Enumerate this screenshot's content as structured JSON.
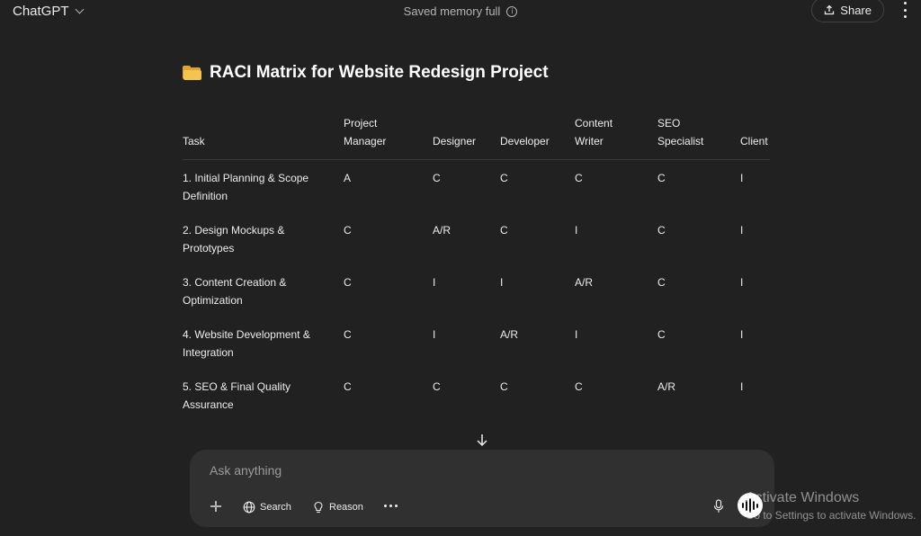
{
  "header": {
    "app_name": "ChatGPT",
    "status_text": "Saved memory full",
    "info_glyph": "i",
    "share_label": "Share"
  },
  "document": {
    "title": "RACI Matrix for Website Redesign Project",
    "title_icon": "folder-icon",
    "table": {
      "headers": [
        {
          "line1": "Task",
          "line2": ""
        },
        {
          "line1": "Project",
          "line2": "Manager"
        },
        {
          "line1": "Designer",
          "line2": ""
        },
        {
          "line1": "Developer",
          "line2": ""
        },
        {
          "line1": "Content",
          "line2": "Writer"
        },
        {
          "line1": "SEO",
          "line2": "Specialist"
        },
        {
          "line1": "Client",
          "line2": ""
        }
      ],
      "rows": [
        {
          "task_line1": "1. Initial Planning & Scope",
          "task_line2": "Definition",
          "cells": [
            "A",
            "C",
            "C",
            "C",
            "C",
            "I"
          ]
        },
        {
          "task_line1": "2. Design Mockups &",
          "task_line2": "Prototypes",
          "cells": [
            "C",
            "A/R",
            "C",
            "I",
            "C",
            "I"
          ]
        },
        {
          "task_line1": "3. Content Creation &",
          "task_line2": "Optimization",
          "cells": [
            "C",
            "I",
            "I",
            "A/R",
            "C",
            "I"
          ]
        },
        {
          "task_line1": "4. Website Development &",
          "task_line2": "Integration",
          "cells": [
            "C",
            "I",
            "A/R",
            "I",
            "C",
            "I"
          ]
        },
        {
          "task_line1": "5. SEO & Final Quality",
          "task_line2": "Assurance",
          "cells": [
            "C",
            "C",
            "C",
            "C",
            "A/R",
            "I"
          ]
        }
      ]
    }
  },
  "composer": {
    "placeholder": "Ask anything",
    "search_label": "Search",
    "reason_label": "Reason"
  },
  "watermark": {
    "line1": "Activate Windows",
    "line2": "Go to Settings to activate Windows."
  },
  "colors": {
    "background": "#212121",
    "composer_bg": "#303030",
    "text": "#ececec",
    "muted": "#b4b4b4",
    "folder_accent": "#f6c34c"
  }
}
